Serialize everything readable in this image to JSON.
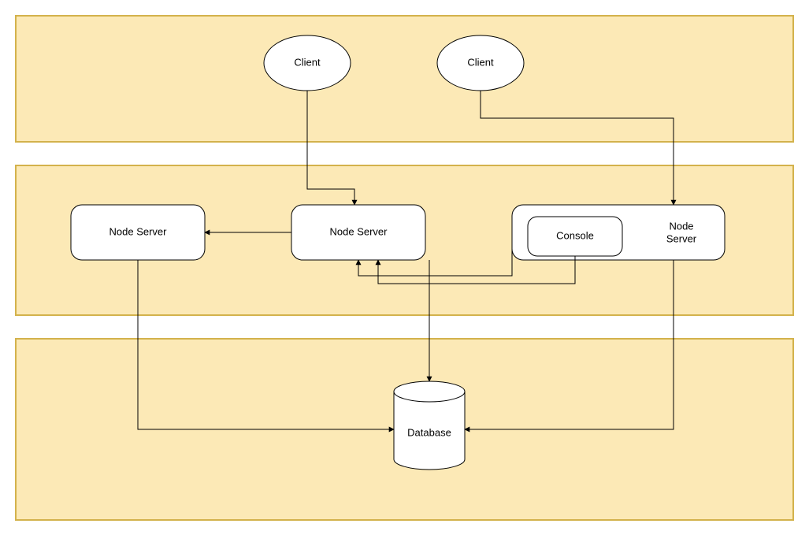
{
  "nodes": {
    "client_left": {
      "label": "Client"
    },
    "client_right": {
      "label": "Client"
    },
    "node_server_left": {
      "label": "Node Server"
    },
    "node_server_mid": {
      "label": "Node Server"
    },
    "node_server_right": {
      "label": "Node\nServer"
    },
    "console": {
      "label": "Console"
    },
    "database": {
      "label": "Database"
    }
  },
  "tiers": {
    "client_tier": "",
    "server_tier": "",
    "data_tier": ""
  }
}
